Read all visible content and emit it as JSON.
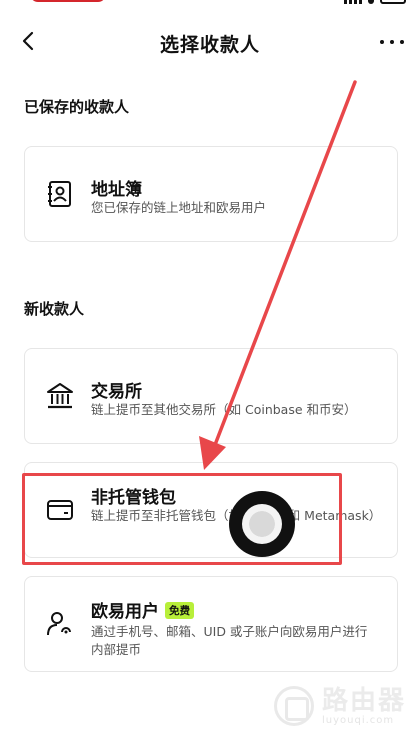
{
  "nav": {
    "title": "选择收款人"
  },
  "sections": {
    "saved_title": "已保存的收款人",
    "new_title": "新收款人"
  },
  "cards": {
    "address_book": {
      "title": "地址簿",
      "desc": "您已保存的链上地址和欧易用户",
      "icon": "contact-book-icon"
    },
    "exchange": {
      "title": "交易所",
      "desc": "链上提币至其他交易所（如 Coinbase 和币安）",
      "icon": "bank-building-icon"
    },
    "wallet": {
      "title": "非托管钱包",
      "desc": "链上提币至非托管钱包（如 Wallet 和 Metamask）",
      "icon": "wallet-icon"
    },
    "okx_user": {
      "title": "欧易用户",
      "badge": "免费",
      "desc": "通过手机号、邮箱、UID 或子账户向欧易用户进行内部提币",
      "icon": "user-icon"
    }
  },
  "watermark": {
    "name": "路由器",
    "url": "luyouqi.com"
  },
  "colors": {
    "annotation_red": "#e8474a",
    "badge_green": "#b8ef3a",
    "status_red": "#d4262c"
  }
}
